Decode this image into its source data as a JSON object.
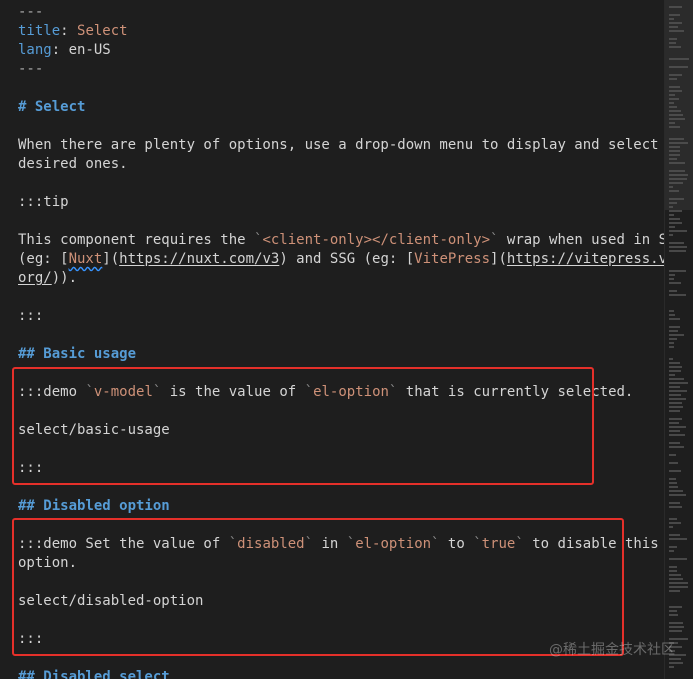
{
  "editor": {
    "lines": {
      "fm_open": "---",
      "title_key": "title",
      "title_colon": ": ",
      "title_val": "Select",
      "lang_key": "lang",
      "lang_colon": ": ",
      "lang_val": "en-US",
      "fm_close": "---",
      "h1": "# Select",
      "intro_1": "When there are plenty of options, use a drop-down menu to display and select",
      "intro_2": "desired ones.",
      "tip_open": ":::tip",
      "req_a": "This component requires the ",
      "req_code": "<client-only></client-only>",
      "req_b": " wrap when used in SSR",
      "req2_a": "(eg: [",
      "req2_link": "Nuxt",
      "req2_b": "](",
      "req2_url": "https://nuxt.com/v3",
      "req2_c": ") and SSG (eg: [",
      "req2_link2": "VitePress",
      "req2_d": "](",
      "req2_url2": "https://vitepress.vuejs.",
      "req3_url": "org/",
      "req3_b": ")).",
      "tip_close": ":::",
      "h2_basic": "## Basic usage",
      "basic_a": ":::demo ",
      "basic_code1": "v-model",
      "basic_b": " is the value of ",
      "basic_code2": "el-option",
      "basic_c": " that is currently selected.",
      "basic_path": "select/basic-usage",
      "basic_close": ":::",
      "h2_disabled_opt": "## Disabled option",
      "dis_a": ":::demo Set the value of ",
      "dis_code1": "disabled",
      "dis_b": " in ",
      "dis_code2": "el-option",
      "dis_c": " to ",
      "dis_code3": "true",
      "dis_d": " to disable this",
      "dis_2": "option.",
      "dis_path": "select/disabled-option",
      "dis_close": ":::",
      "h2_disabled_sel": "## Disabled select"
    },
    "tick": "`"
  },
  "watermark": "@稀土掘金技术社区",
  "colors": {
    "background": "#1e1e1e",
    "key": "#569cd6",
    "string": "#ce9178",
    "highlight": "#e5302a"
  }
}
